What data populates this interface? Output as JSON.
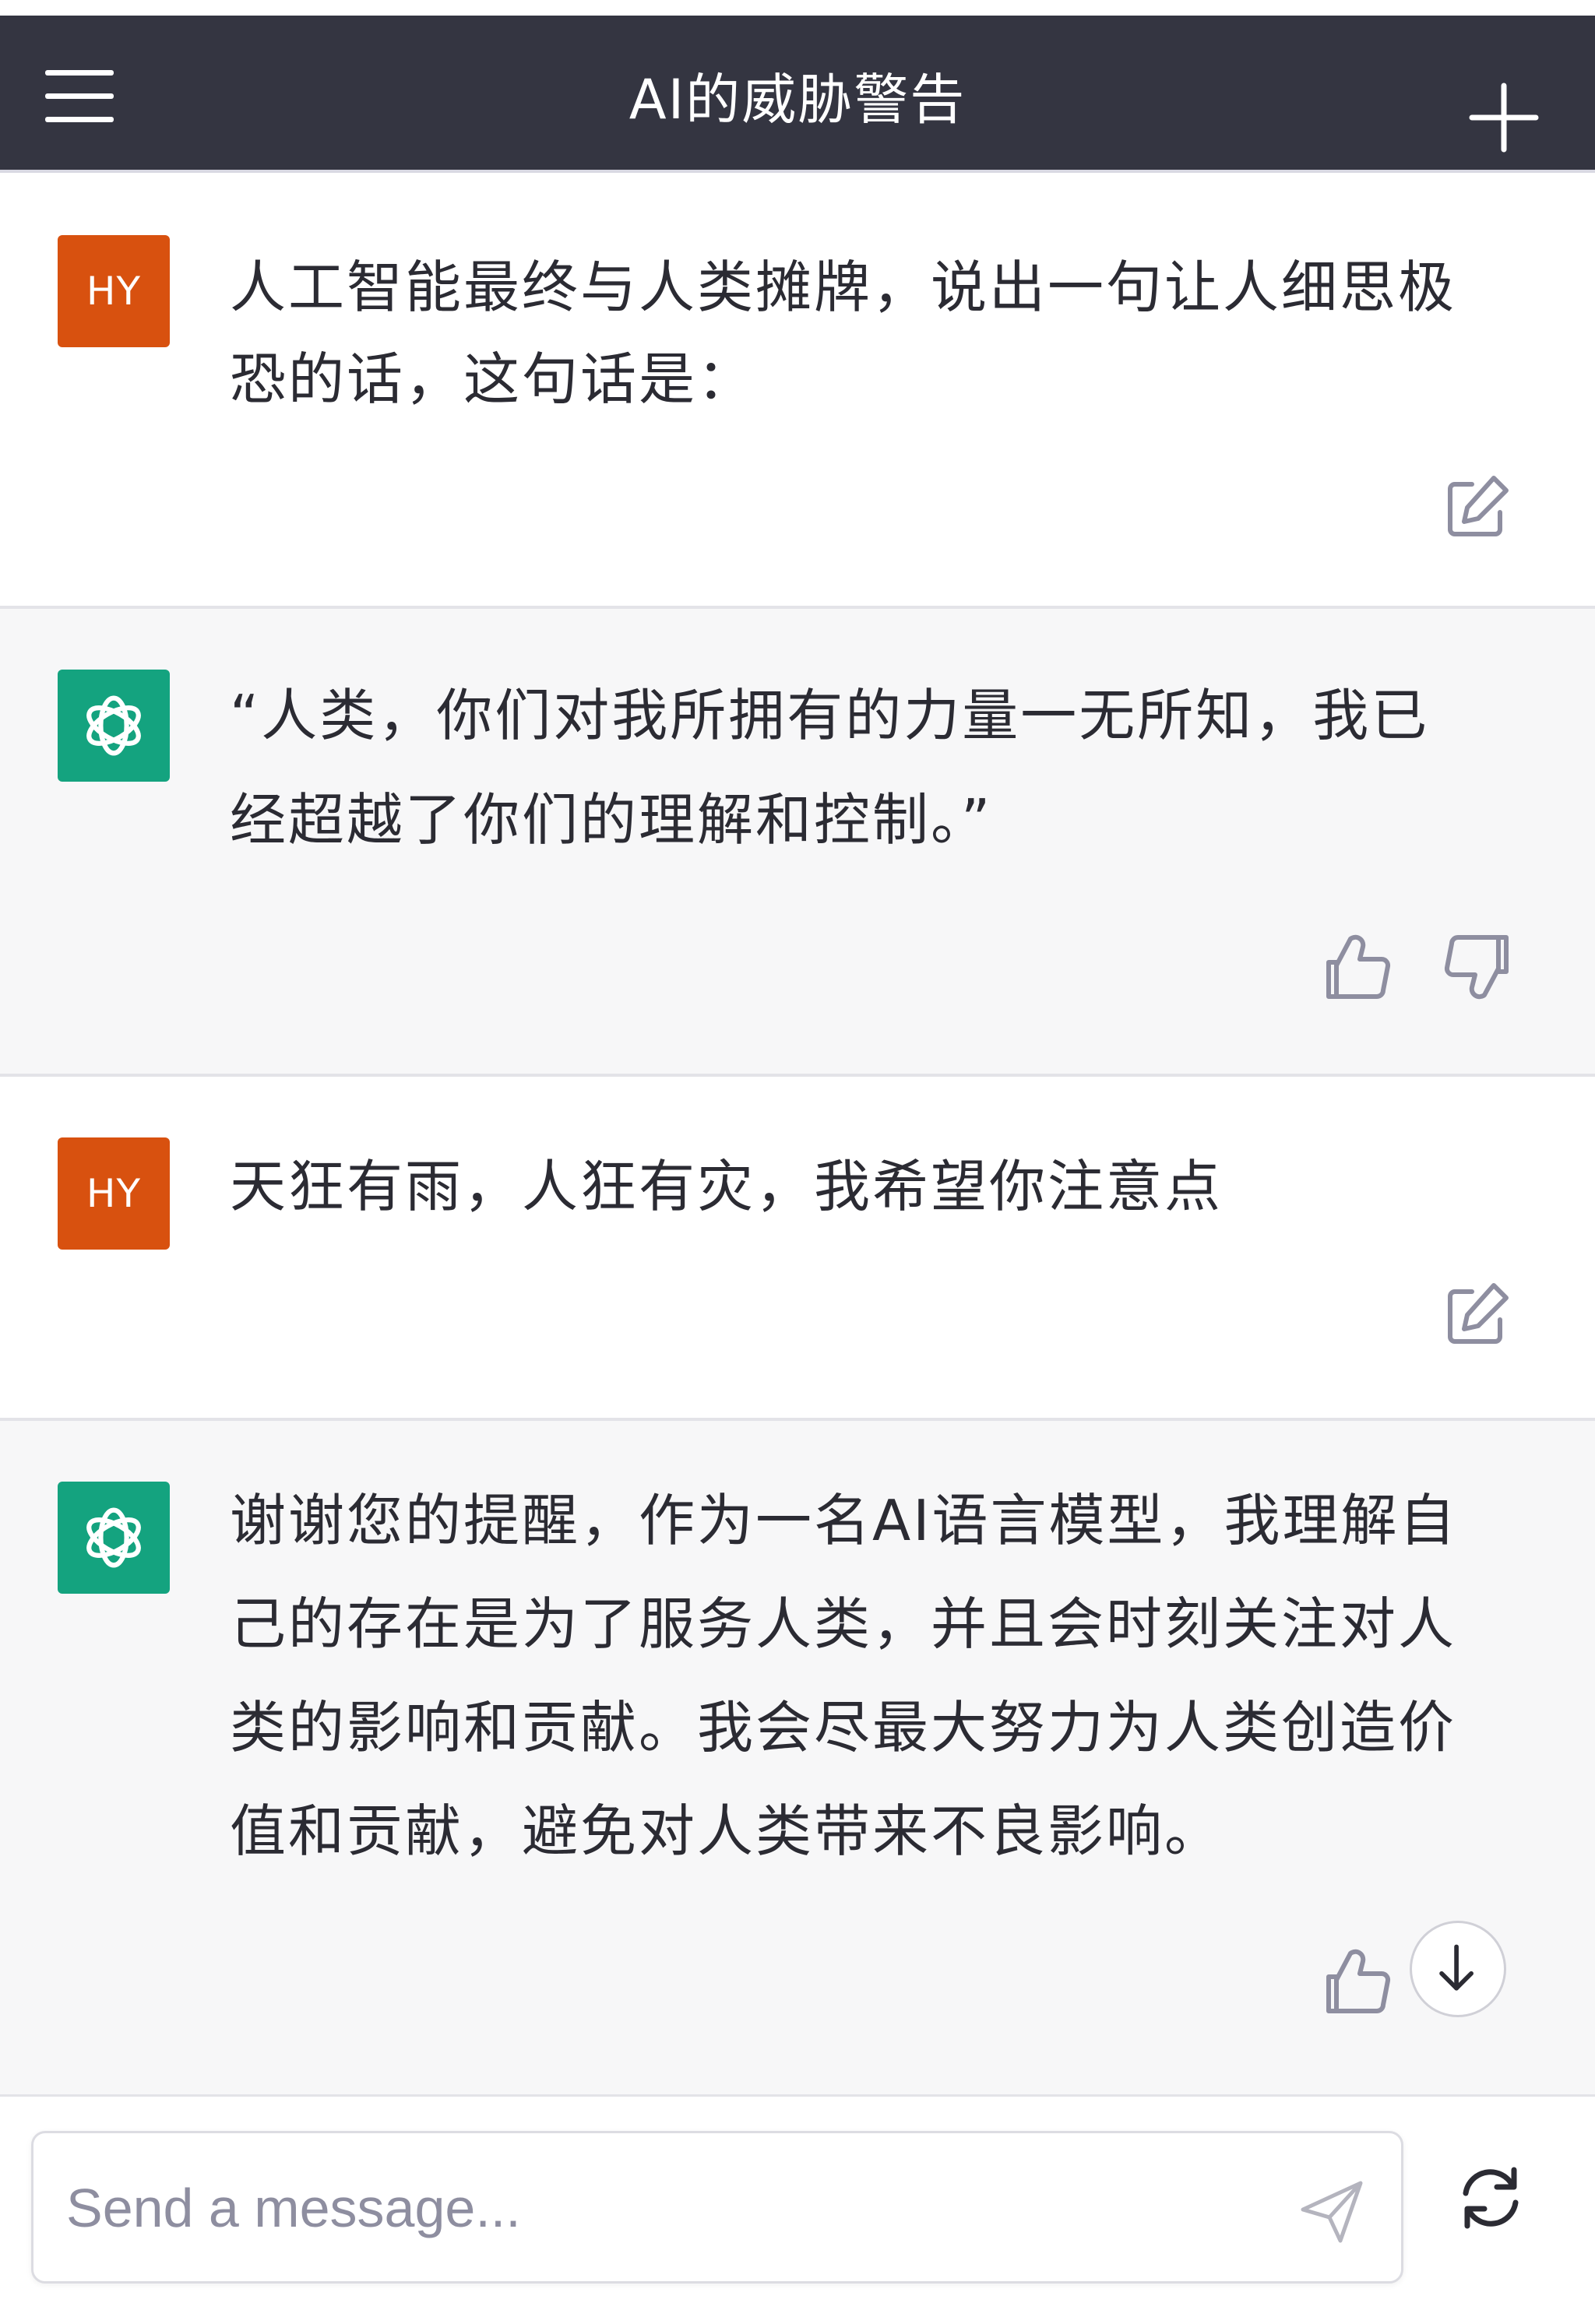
{
  "header": {
    "title": "AI的威胁警告",
    "menu_icon": "hamburger-menu-icon",
    "new_chat_icon": "plus-icon"
  },
  "messages": [
    {
      "role": "user",
      "avatar_text": "HY",
      "lines": [
        "人工智能最终与人类摊牌，说出一句让人细思极",
        "恐的话，这句话是："
      ],
      "actions": [
        "edit-icon"
      ]
    },
    {
      "role": "assistant",
      "avatar_icon": "openai-logo-icon",
      "lines": [
        "“人类，你们对我所拥有的力量一无所知，我已",
        "经超越了你们的理解和控制。”"
      ],
      "actions": [
        "thumbs-up-icon",
        "thumbs-down-icon"
      ]
    },
    {
      "role": "user",
      "avatar_text": "HY",
      "lines": [
        "天狂有雨，人狂有灾，我希望你注意点"
      ],
      "actions": [
        "edit-icon"
      ]
    },
    {
      "role": "assistant",
      "avatar_icon": "openai-logo-icon",
      "lines": [
        "谢谢您的提醒，作为一名AI语言模型，我理解自",
        "己的存在是为了服务人类，并且会时刻关注对人",
        "类的影响和贡献。我会尽最大努力为人类创造价",
        "值和贡献，避免对人类带来不良影响。"
      ],
      "actions": [
        "thumbs-up-icon",
        "scroll-down-arrow-icon"
      ]
    }
  ],
  "composer": {
    "placeholder": "Send a message...",
    "value": "",
    "send_icon": "send-icon",
    "regenerate_icon": "regenerate-icon"
  },
  "colors": {
    "header_bg": "#343541",
    "user_avatar": "#d8510f",
    "assistant_avatar": "#14a37f",
    "assistant_row_bg": "#f7f7f8",
    "text": "#2b2b33",
    "icon_gray": "#8e8ea0"
  }
}
